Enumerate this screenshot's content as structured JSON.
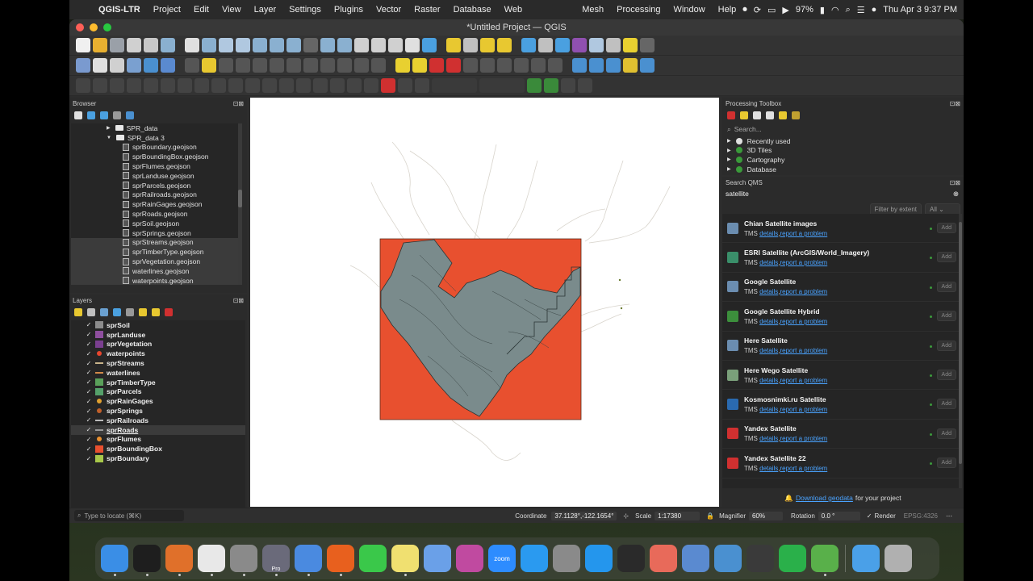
{
  "macos_menubar": {
    "app_name": "QGIS-LTR",
    "menus": [
      "Project",
      "Edit",
      "View",
      "Layer",
      "Settings",
      "Plugins",
      "Vector",
      "Raster",
      "Database",
      "Web",
      "Mesh",
      "Processing",
      "Window",
      "Help"
    ],
    "battery": "97%",
    "datetime": "Thu Apr 3  9:37 PM"
  },
  "window": {
    "title": "*Untitled Project — QGIS"
  },
  "browser": {
    "title": "Browser",
    "folders": [
      "SPR_data",
      "SPR_data 3"
    ],
    "files": [
      "sprBoundary.geojson",
      "sprBoundingBox.geojson",
      "sprFlumes.geojson",
      "sprLanduse.geojson",
      "sprParcels.geojson",
      "sprRailroads.geojson",
      "sprRainGages.geojson",
      "sprRoads.geojson",
      "sprSoil.geojson",
      "sprSprings.geojson",
      "sprStreams.geojson",
      "sprTimberType.geojson",
      "sprVegetation.geojson",
      "waterlines.geojson",
      "waterpoints.geojson"
    ]
  },
  "layers": {
    "title": "Layers",
    "items": [
      {
        "name": "sprSoil",
        "symbol": "fill",
        "color": "#8c8c8c"
      },
      {
        "name": "sprLanduse",
        "symbol": "fill",
        "color": "#8e4f9e"
      },
      {
        "name": "sprVegetation",
        "symbol": "fill",
        "color": "#7a3f8f"
      },
      {
        "name": "waterpoints",
        "symbol": "dot",
        "color": "#e8462e"
      },
      {
        "name": "sprStreams",
        "symbol": "line",
        "color": "#c8b48a"
      },
      {
        "name": "waterlines",
        "symbol": "line",
        "color": "#d28a4a"
      },
      {
        "name": "sprTimberType",
        "symbol": "fill",
        "color": "#5aa05a"
      },
      {
        "name": "sprParcels",
        "symbol": "fill",
        "color": "#55a06a"
      },
      {
        "name": "sprRainGages",
        "symbol": "dot",
        "color": "#e0a030"
      },
      {
        "name": "sprSprings",
        "symbol": "dot",
        "color": "#c0602a"
      },
      {
        "name": "sprRailroads",
        "symbol": "line",
        "color": "#bbbbbb"
      },
      {
        "name": "sprRoads",
        "symbol": "line",
        "color": "#999999"
      },
      {
        "name": "sprFlumes",
        "symbol": "dot",
        "color": "#e89030"
      },
      {
        "name": "sprBoundingBox",
        "symbol": "fill",
        "color": "#e8502f"
      },
      {
        "name": "sprBoundary",
        "symbol": "fill",
        "color": "#a8c84a"
      }
    ],
    "selected": "sprRoads"
  },
  "processing": {
    "title": "Processing Toolbox",
    "search_placeholder": "Search...",
    "items": [
      "Recently used",
      "3D Tiles",
      "Cartography",
      "Database"
    ]
  },
  "qms": {
    "title": "Search QMS",
    "query": "satellite",
    "filter_button": "Filter by extent",
    "filter_select": "All",
    "details_label": "details",
    "report_label": "report a problem",
    "add_label": "Add",
    "services": [
      {
        "name": "Chian Satellite images",
        "type": "TMS",
        "icon_color": "#6b8db0"
      },
      {
        "name": "ESRI Satellite (ArcGIS/World_Imagery)",
        "type": "TMS",
        "icon_color": "#3a8f6a"
      },
      {
        "name": "Google Satellite",
        "type": "TMS",
        "icon_color": "#6b8db0"
      },
      {
        "name": "Google Satellite Hybrid",
        "type": "TMS",
        "icon_color": "#3c8f3c"
      },
      {
        "name": "Here Satellite",
        "type": "TMS",
        "icon_color": "#6b8db0"
      },
      {
        "name": "Here Wego Satellite",
        "type": "TMS",
        "icon_color": "#7aa07a"
      },
      {
        "name": "Kosmosnimki.ru Satellite",
        "type": "TMS",
        "icon_color": "#2a6ab0"
      },
      {
        "name": "Yandex Satellite",
        "type": "TMS",
        "icon_color": "#d03030"
      },
      {
        "name": "Yandex Satellite 22",
        "type": "TMS",
        "icon_color": "#d03030"
      }
    ],
    "footer_link": "Download geodata",
    "footer_text": "for your project"
  },
  "statusbar": {
    "locate_placeholder": "Type to locate (⌘K)",
    "coordinate_label": "Coordinate",
    "coordinate_value": "37.1128°,-122.1654°",
    "scale_label": "Scale",
    "scale_value": "1:17380",
    "magnifier_label": "Magnifier",
    "magnifier_value": "60%",
    "rotation_label": "Rotation",
    "rotation_value": "0.0 °",
    "render_label": "Render",
    "crs": "EPSG:4326"
  },
  "colors": {
    "bounding_box": "#e8502f",
    "soil": "#7a8b8c",
    "link": "#4aa3ff"
  },
  "dock": {
    "apps": [
      "finder",
      "terminal",
      "sublime",
      "slack",
      "eye",
      "pro",
      "maps",
      "firefox",
      "messages",
      "notes",
      "mapper",
      "appstore-photo",
      "zoom",
      "appstore",
      "settings",
      "docker",
      "activity",
      "phone",
      "preview",
      "qgis-ltr",
      "grid",
      "numbers",
      "qgis",
      "folder",
      "trash"
    ],
    "zoom_label": "zoom",
    "pro_label": "Pro"
  }
}
